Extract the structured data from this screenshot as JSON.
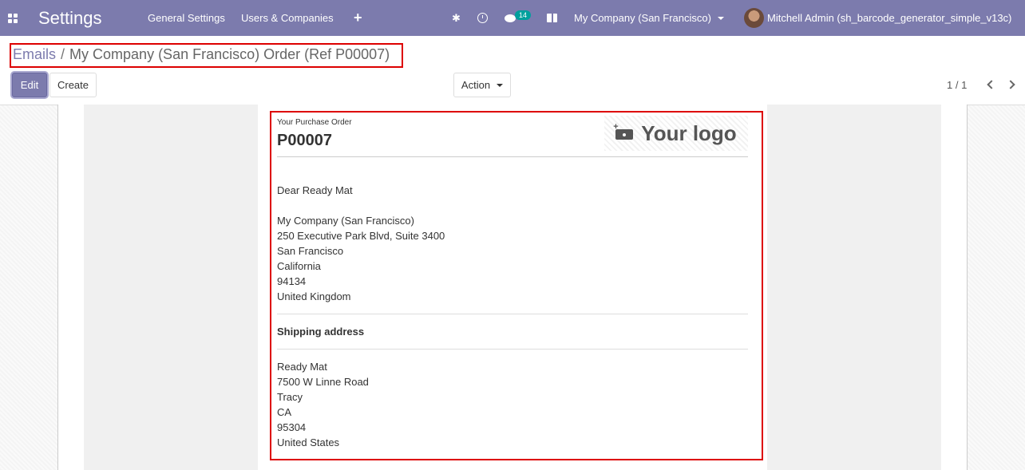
{
  "navbar": {
    "app_title": "Settings",
    "menu": [
      "General Settings",
      "Users & Companies",
      "+"
    ],
    "message_count": "14",
    "company": "My Company (San Francisco)",
    "user": "Mitchell Admin (sh_barcode_generator_simple_v13c)"
  },
  "breadcrumb": {
    "parent": "Emails",
    "separator": "/",
    "current": "My Company (San Francisco) Order (Ref P00007)"
  },
  "buttons": {
    "edit": "Edit",
    "create": "Create",
    "action": "Action"
  },
  "pager": {
    "value": "1 / 1"
  },
  "email": {
    "header_label": "Your Purchase Order",
    "order_number": "P00007",
    "logo_text": "Your logo",
    "greeting": "Dear Ready Mat",
    "company_address": [
      "My Company (San Francisco)",
      "250 Executive Park Blvd, Suite 3400",
      "San Francisco",
      "California",
      "94134",
      "United Kingdom"
    ],
    "shipping_heading": "Shipping address",
    "shipping_address": [
      "Ready Mat",
      "7500 W Linne Road",
      "Tracy",
      "CA",
      "95304",
      "United States"
    ]
  },
  "colors": {
    "navbar": "#7c7bad",
    "badge": "#00a09d",
    "highlight": "#dd0000"
  }
}
